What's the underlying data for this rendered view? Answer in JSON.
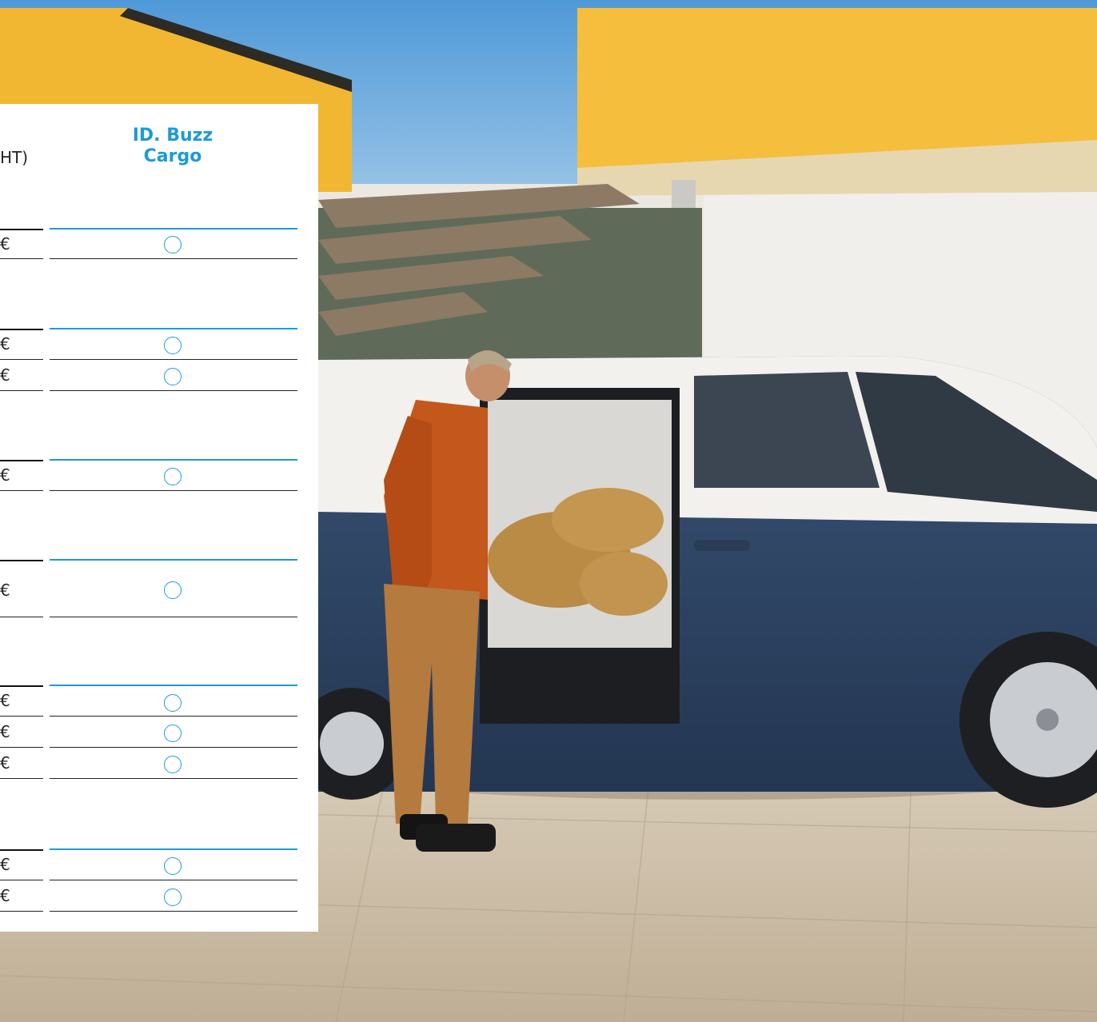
{
  "table": {
    "header_left": "HT)",
    "header_right_line1": "ID. Buzz",
    "header_right_line2": "Cargo",
    "rows": [
      {
        "left": "€"
      },
      {
        "left": "€"
      },
      {
        "left": "€"
      },
      {
        "left": "€"
      },
      {
        "left": "€"
      },
      {
        "left": "€"
      },
      {
        "left": "€"
      },
      {
        "left": "€"
      },
      {
        "left": "€"
      },
      {
        "left": "€"
      }
    ]
  },
  "photo": {
    "description_colors": {
      "sky": "#7fb5e0",
      "yellow_wall": "#f2b732",
      "van_body": "#2f4563",
      "van_top": "#f2f1ee",
      "ground": "#cdbfa9",
      "accent_blue": "#1d9ad6"
    }
  }
}
